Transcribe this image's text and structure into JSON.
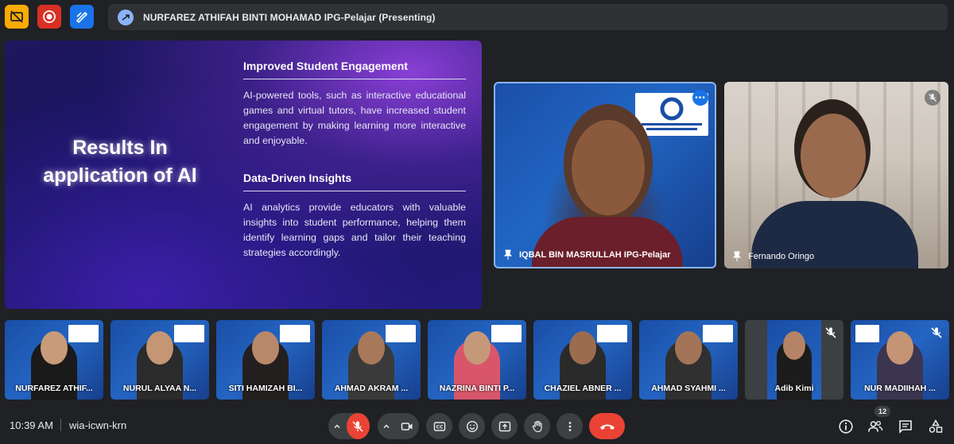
{
  "presenting_banner": "NURFAREZ ATHIFAH BINTI MOHAMAD IPG-Pelajar (Presenting)",
  "slide": {
    "title": "Results In application of AI",
    "sections": [
      {
        "heading": "Improved Student Engagement",
        "body": "AI-powered tools, such as interactive educational games and virtual tutors, have increased student engagement by making learning more interactive and enjoyable."
      },
      {
        "heading": "Data-Driven Insights",
        "body": "AI analytics provide educators with valuable insights into student performance, helping them identify learning gaps and tailor their teaching strategies accordingly."
      }
    ]
  },
  "main_tiles": [
    {
      "name": "IQBAL BIN MASRULLAH IPG-Pelajar"
    },
    {
      "name": "Fernando Oringo"
    }
  ],
  "thumbnails": [
    {
      "name": "NURFAREZ ATHIF..."
    },
    {
      "name": "NURUL ALYAA N..."
    },
    {
      "name": "SITI HAMIZAH BI..."
    },
    {
      "name": "AHMAD AKRAM ..."
    },
    {
      "name": "NAZRINA BINTI P..."
    },
    {
      "name": "CHAZIEL ABNER ..."
    },
    {
      "name": "AHMAD SYAHMI ..."
    },
    {
      "name": "Adib Kimi"
    },
    {
      "name": "NUR MADIIHAH ..."
    }
  ],
  "bottom_bar": {
    "time": "10:39 AM",
    "meeting_code": "wia-icwn-krn",
    "participant_count": "12"
  },
  "colors": {
    "accent_blue": "#8ab4f8",
    "mic_off_red": "#ea4335",
    "control_bg": "#3c4043",
    "page_bg": "#202124"
  }
}
